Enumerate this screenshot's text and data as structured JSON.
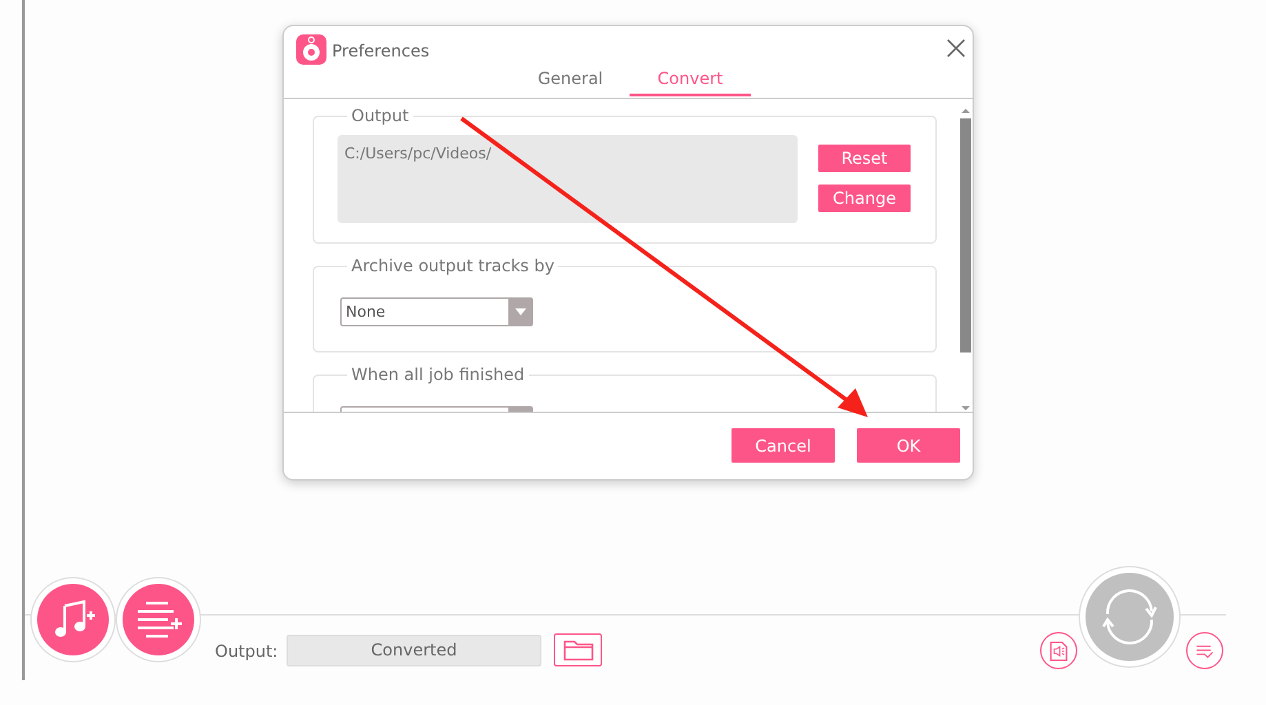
{
  "dialog": {
    "title": "Preferences",
    "tabs": [
      {
        "label": "General",
        "selected": false
      },
      {
        "label": "Convert",
        "selected": true
      }
    ],
    "sections": [
      {
        "kind": "path",
        "legend": "Output",
        "value": "C:/Users/pc/Videos/",
        "buttons": [
          "Reset",
          "Change"
        ]
      },
      {
        "kind": "select",
        "legend": "Archive output tracks by",
        "value": "None"
      },
      {
        "kind": "select",
        "legend": "When all job finished"
      }
    ],
    "buttons": [
      "Cancel",
      "OK"
    ]
  },
  "bottom_bar": {
    "output_label": "Output:",
    "output_value": "Converted"
  }
}
